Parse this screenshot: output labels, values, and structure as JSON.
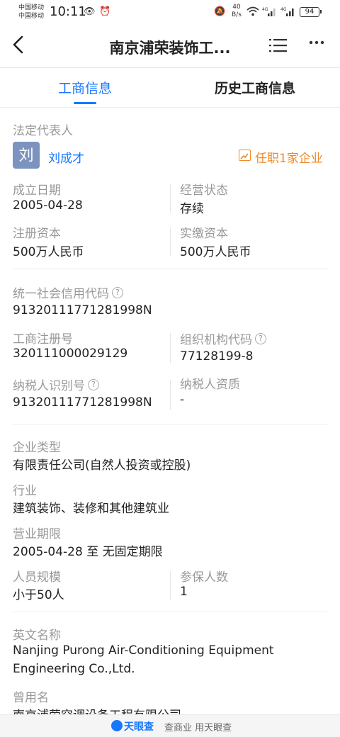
{
  "status_bar": {
    "carrier1": "中国移动",
    "carrier2": "中国移动",
    "time": "10:11",
    "net_speed_value": "40",
    "net_speed_unit": "B/s",
    "battery": "94"
  },
  "nav": {
    "title": "南京浦荣装饰工..."
  },
  "tabs": [
    {
      "label": "工商信息"
    },
    {
      "label": "历史工商信息"
    }
  ],
  "legal_rep": {
    "label": "法定代表人",
    "avatar_char": "刘",
    "name": "刘成才",
    "position_link": "任职1家企业"
  },
  "fields": {
    "established_label": "成立日期",
    "established_value": "2005-04-28",
    "status_label": "经营状态",
    "status_value": "存续",
    "reg_capital_label": "注册资本",
    "reg_capital_value": "500万人民币",
    "paid_capital_label": "实缴资本",
    "paid_capital_value": "500万人民币",
    "credit_code_label": "统一社会信用代码",
    "credit_code_value": "91320111771281998N",
    "reg_no_label": "工商注册号",
    "reg_no_value": "320111000029129",
    "org_code_label": "组织机构代码",
    "org_code_value": "77128199-8",
    "taxpayer_id_label": "纳税人识别号",
    "taxpayer_id_value": "91320111771281998N",
    "taxpayer_qual_label": "纳税人资质",
    "taxpayer_qual_value": "-",
    "company_type_label": "企业类型",
    "company_type_value": "有限责任公司(自然人投资或控股)",
    "industry_label": "行业",
    "industry_value": "建筑装饰、装修和其他建筑业",
    "term_label": "营业期限",
    "term_value": "2005-04-28 至 无固定期限",
    "staff_label": "人员规模",
    "staff_value": "小于50人",
    "insured_label": "参保人数",
    "insured_value": "1",
    "english_name_label": "英文名称",
    "english_name_value": "Nanjing Purong Air-Conditioning Equipment Engineering Co.,Ltd.",
    "former_name_label": "曾用名",
    "former_name_value": "南京浦荣空调设备工程有限公司"
  },
  "footer": {
    "brand": "天眼查",
    "slogan": "查商业 用天眼查"
  }
}
